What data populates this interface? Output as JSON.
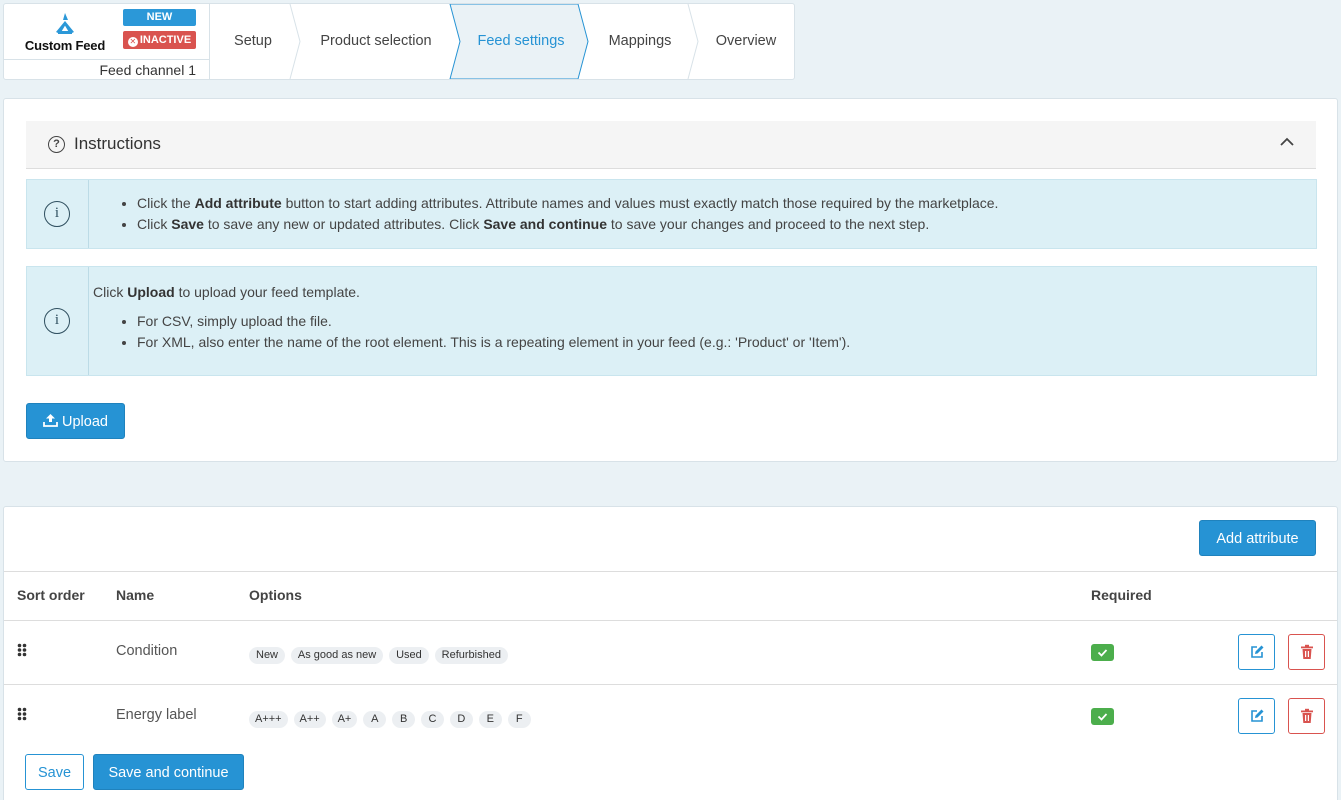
{
  "header": {
    "logo_text": "Custom Feed",
    "badge_new": "NEW",
    "badge_inactive": "INACTIVE",
    "channel_name": "Feed channel 1",
    "steps": [
      {
        "label": "Setup",
        "active": false
      },
      {
        "label": "Product selection",
        "active": false
      },
      {
        "label": "Feed settings",
        "active": true
      },
      {
        "label": "Mappings",
        "active": false
      },
      {
        "label": "Overview",
        "active": false
      }
    ]
  },
  "instructions": {
    "title": "Instructions",
    "alert1": {
      "line1": {
        "pre": "Click the ",
        "bold": "Add attribute",
        "post": " button to start adding attributes. Attribute names and values must exactly match those required by the marketplace."
      },
      "line2": {
        "pre": "Click ",
        "bold1": "Save",
        "mid": " to save any new or updated attributes. Click ",
        "bold2": "Save and continue",
        "post": " to save your changes and proceed to the next step."
      }
    },
    "alert2": {
      "lead": {
        "pre": "Click ",
        "bold": "Upload",
        "post": " to upload your feed template."
      },
      "items": [
        "For CSV, simply upload the file.",
        "For XML, also enter the name of the root element. This is a repeating element in your feed (e.g.: 'Product' or 'Item')."
      ]
    },
    "upload_label": "Upload"
  },
  "attributes": {
    "add_label": "Add attribute",
    "columns": {
      "sort_order": "Sort order",
      "name": "Name",
      "options": "Options",
      "required": "Required"
    },
    "rows": [
      {
        "name": "Condition",
        "options": [
          "New",
          "As good as new",
          "Used",
          "Refurbished"
        ],
        "required": true
      },
      {
        "name": "Energy label",
        "options": [
          "A+++",
          "A++",
          "A+",
          "A",
          "B",
          "C",
          "D",
          "E",
          "F"
        ],
        "required": true
      }
    ],
    "save_label": "Save",
    "save_continue_label": "Save and continue"
  },
  "colors": {
    "accent": "#2693d4",
    "danger": "#d9534f",
    "success": "#4cae4c",
    "info_bg": "#dcf0f6"
  }
}
